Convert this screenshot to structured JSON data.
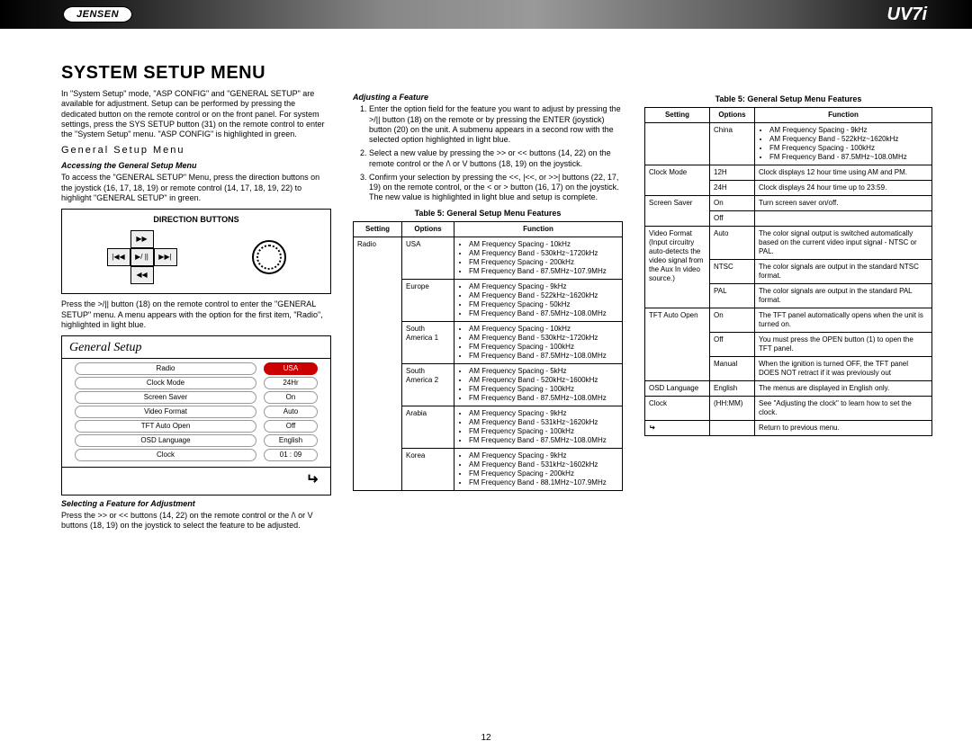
{
  "header": {
    "logo": "JENSEN",
    "model": "UV7i"
  },
  "title": "System Setup Menu",
  "intro": "In \"System Setup\" mode, \"ASP CONFIG\" and \"GENERAL SETUP\" are available for adjustment. Setup can be performed by pressing the dedicated button on the remote control or on the front panel. For system settings, press the SYS SETUP button (31) on the remote control to enter the \"System Setup\" menu. \"ASP CONFIG\" is highlighted in green.",
  "gsm_heading": "General Setup Menu",
  "accessing_h": "Accessing the General Setup Menu",
  "accessing_p": "To access the \"GENERAL SETUP\" Menu, press the direction buttons on the joystick (16, 17, 18, 19) or remote control (14, 17, 18, 19, 22) to highlight \"GENERAL SETUP\" in green.",
  "dir_label": "DIRECTION BUTTONS",
  "dir_up": "▶▶",
  "dir_left": "|◀◀",
  "dir_center": "▶/ ||",
  "dir_right": "▶▶|",
  "dir_down": "◀◀",
  "press_p": "Press the >/|| button (18) on the remote control to enter the \"GENERAL SETUP\" menu. A menu appears with the option for the first item, \"Radio\", highlighted in light blue.",
  "gs_title": "General Setup",
  "gs_rows": [
    {
      "label": "Radio",
      "value": "USA"
    },
    {
      "label": "Clock Mode",
      "value": "24Hr"
    },
    {
      "label": "Screen Saver",
      "value": "On"
    },
    {
      "label": "Video Format",
      "value": "Auto"
    },
    {
      "label": "TFT Auto Open",
      "value": "Off"
    },
    {
      "label": "OSD Language",
      "value": "English"
    },
    {
      "label": "Clock",
      "value": "01 : 09"
    }
  ],
  "selecting_h": "Selecting a Feature for Adjustment",
  "selecting_p": "Press the >> or << buttons (14, 22) on the remote control or the /\\ or V buttons (18, 19) on the joystick to select the feature to be adjusted.",
  "adjusting_h": "Adjusting a Feature",
  "adjusting_steps": [
    "Enter the option field for the feature you want to adjust by pressing the >/|| button (18) on the remote or by pressing the ENTER (joystick) button (20) on the unit. A submenu appears in a second row with the selected option highlighted in light blue.",
    "Select a new value by pressing the >> or << buttons (14, 22) on the remote control or the /\\ or V buttons (18, 19) on the joystick.",
    "Confirm your selection by pressing the <<, |<<, or >>| buttons (22, 17, 19) on the remote control, or the < or > button (16, 17) on the joystick. The new value is highlighted in light blue and setup is complete."
  ],
  "table5_caption": "Table 5: General Setup Menu Features",
  "th_setting": "Setting",
  "th_options": "Options",
  "th_function": "Function",
  "t5a": [
    {
      "setting": "Radio",
      "rows": [
        {
          "opt": "USA",
          "fn": [
            "AM Frequency Spacing - 10kHz",
            "AM Frequency Band - 530kHz~1720kHz",
            "FM Frequency Spacing - 200kHz",
            "FM Frequency Band - 87.5MHz~107.9MHz"
          ]
        },
        {
          "opt": "Europe",
          "fn": [
            "AM Frequency Spacing - 9kHz",
            "AM Frequency Band - 522kHz~1620kHz",
            "FM Frequency Spacing - 50kHz",
            "FM Frequency Band - 87.5MHz~108.0MHz"
          ]
        },
        {
          "opt": "South America 1",
          "fn": [
            "AM Frequency Spacing - 10kHz",
            "AM Frequency Band - 530kHz~1720kHz",
            "FM Frequency Spacing - 100kHz",
            "FM Frequency Band - 87.5MHz~108.0MHz"
          ]
        },
        {
          "opt": "South America 2",
          "fn": [
            "AM Frequency Spacing - 5kHz",
            "AM Frequency Band - 520kHz~1600kHz",
            "FM Frequency Spacing - 100kHz",
            "FM Frequency Band - 87.5MHz~108.0MHz"
          ]
        },
        {
          "opt": "Arabia",
          "fn": [
            "AM Frequency Spacing - 9kHz",
            "AM Frequency Band - 531kHz~1620kHz",
            "FM Frequency Spacing - 100kHz",
            "FM Frequency Band - 87.5MHz~108.0MHz"
          ]
        },
        {
          "opt": "Korea",
          "fn": [
            "AM Frequency Spacing - 9kHz",
            "AM Frequency Band - 531kHz~1602kHz",
            "FM Frequency Spacing - 200kHz",
            "FM Frequency Band - 88.1MHz~107.9MHz"
          ]
        }
      ]
    }
  ],
  "t5b": [
    {
      "setting": "",
      "rows": [
        {
          "opt": "China",
          "fn": [
            "AM Frequency Spacing - 9kHz",
            "AM Frequency Band - 522kHz~1620kHz",
            "FM Frequency Spacing - 100kHz",
            "FM Frequency Band - 87.5MHz~108.0MHz"
          ]
        }
      ]
    },
    {
      "setting": "Clock Mode",
      "rows": [
        {
          "opt": "12H",
          "fnp": "Clock displays 12 hour time using AM and PM."
        },
        {
          "opt": "24H",
          "fnp": "Clock displays 24 hour time up to 23:59."
        }
      ]
    },
    {
      "setting": "Screen Saver",
      "rows": [
        {
          "opt": "On",
          "fnp": "Turn screen saver on/off."
        },
        {
          "opt": "Off",
          "fnp": ""
        }
      ]
    },
    {
      "setting": "Video Format (Input circuitry auto-detects the video signal from the Aux In video source.)",
      "rows": [
        {
          "opt": "Auto",
          "fnp": "The color signal output is switched automatically based on the current video input signal - NTSC or PAL."
        },
        {
          "opt": "NTSC",
          "fnp": "The color signals are output in the standard NTSC format."
        },
        {
          "opt": "PAL",
          "fnp": "The color signals are output in the standard PAL format."
        }
      ]
    },
    {
      "setting": "TFT Auto Open",
      "rows": [
        {
          "opt": "On",
          "fnp": "The TFT panel automatically opens when the unit is turned on."
        },
        {
          "opt": "Off",
          "fnp": "You must press the OPEN button (1) to open the TFT panel."
        },
        {
          "opt": "Manual",
          "fnp": "When the ignition is turned OFF, the TFT panel DOES NOT retract if it was previously out"
        }
      ]
    },
    {
      "setting": "OSD Language",
      "rows": [
        {
          "opt": "English",
          "fnp": "The menus are displayed in English only."
        }
      ]
    },
    {
      "setting": "Clock",
      "rows": [
        {
          "opt": "(HH:MM)",
          "fnp": "See \"Adjusting the clock\" to learn how to set the clock."
        }
      ]
    },
    {
      "setting": "↩",
      "rows": [
        {
          "opt": "",
          "fnp": "Return to previous menu."
        }
      ]
    }
  ],
  "pagenum": "12"
}
